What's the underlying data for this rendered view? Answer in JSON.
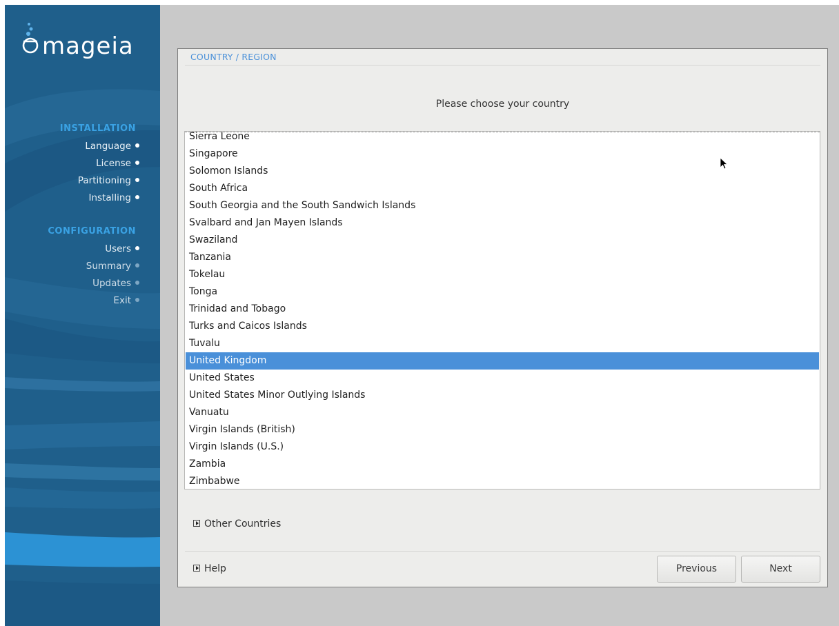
{
  "sidebar": {
    "logo_text": "mageia",
    "sections": [
      {
        "title": "INSTALLATION",
        "items": [
          {
            "label": "Language",
            "done": true
          },
          {
            "label": "License",
            "done": true
          },
          {
            "label": "Partitioning",
            "done": true
          },
          {
            "label": "Installing",
            "done": true
          }
        ]
      },
      {
        "title": "CONFIGURATION",
        "items": [
          {
            "label": "Users",
            "done": true
          },
          {
            "label": "Summary",
            "done": false
          },
          {
            "label": "Updates",
            "done": false
          },
          {
            "label": "Exit",
            "done": false
          }
        ]
      }
    ]
  },
  "dialog": {
    "title": "COUNTRY / REGION",
    "prompt": "Please choose your country",
    "countries": [
      "Sierra Leone",
      "Singapore",
      "Solomon Islands",
      "South Africa",
      "South Georgia and the South Sandwich Islands",
      "Svalbard and Jan Mayen Islands",
      "Swaziland",
      "Tanzania",
      "Tokelau",
      "Tonga",
      "Trinidad and Tobago",
      "Turks and Caicos Islands",
      "Tuvalu",
      "United Kingdom",
      "United States",
      "United States Minor Outlying Islands",
      "Vanuatu",
      "Virgin Islands (British)",
      "Virgin Islands (U.S.)",
      "Zambia",
      "Zimbabwe"
    ],
    "selected_country": "United Kingdom",
    "other_countries_label": "Other Countries",
    "help_label": "Help",
    "previous_label": "Previous",
    "next_label": "Next"
  },
  "colors": {
    "sidebar_bg": "#1f5f8b",
    "section_title": "#3aa2e4",
    "selection": "#4a90d9",
    "dialog_bg": "#ededeb"
  }
}
